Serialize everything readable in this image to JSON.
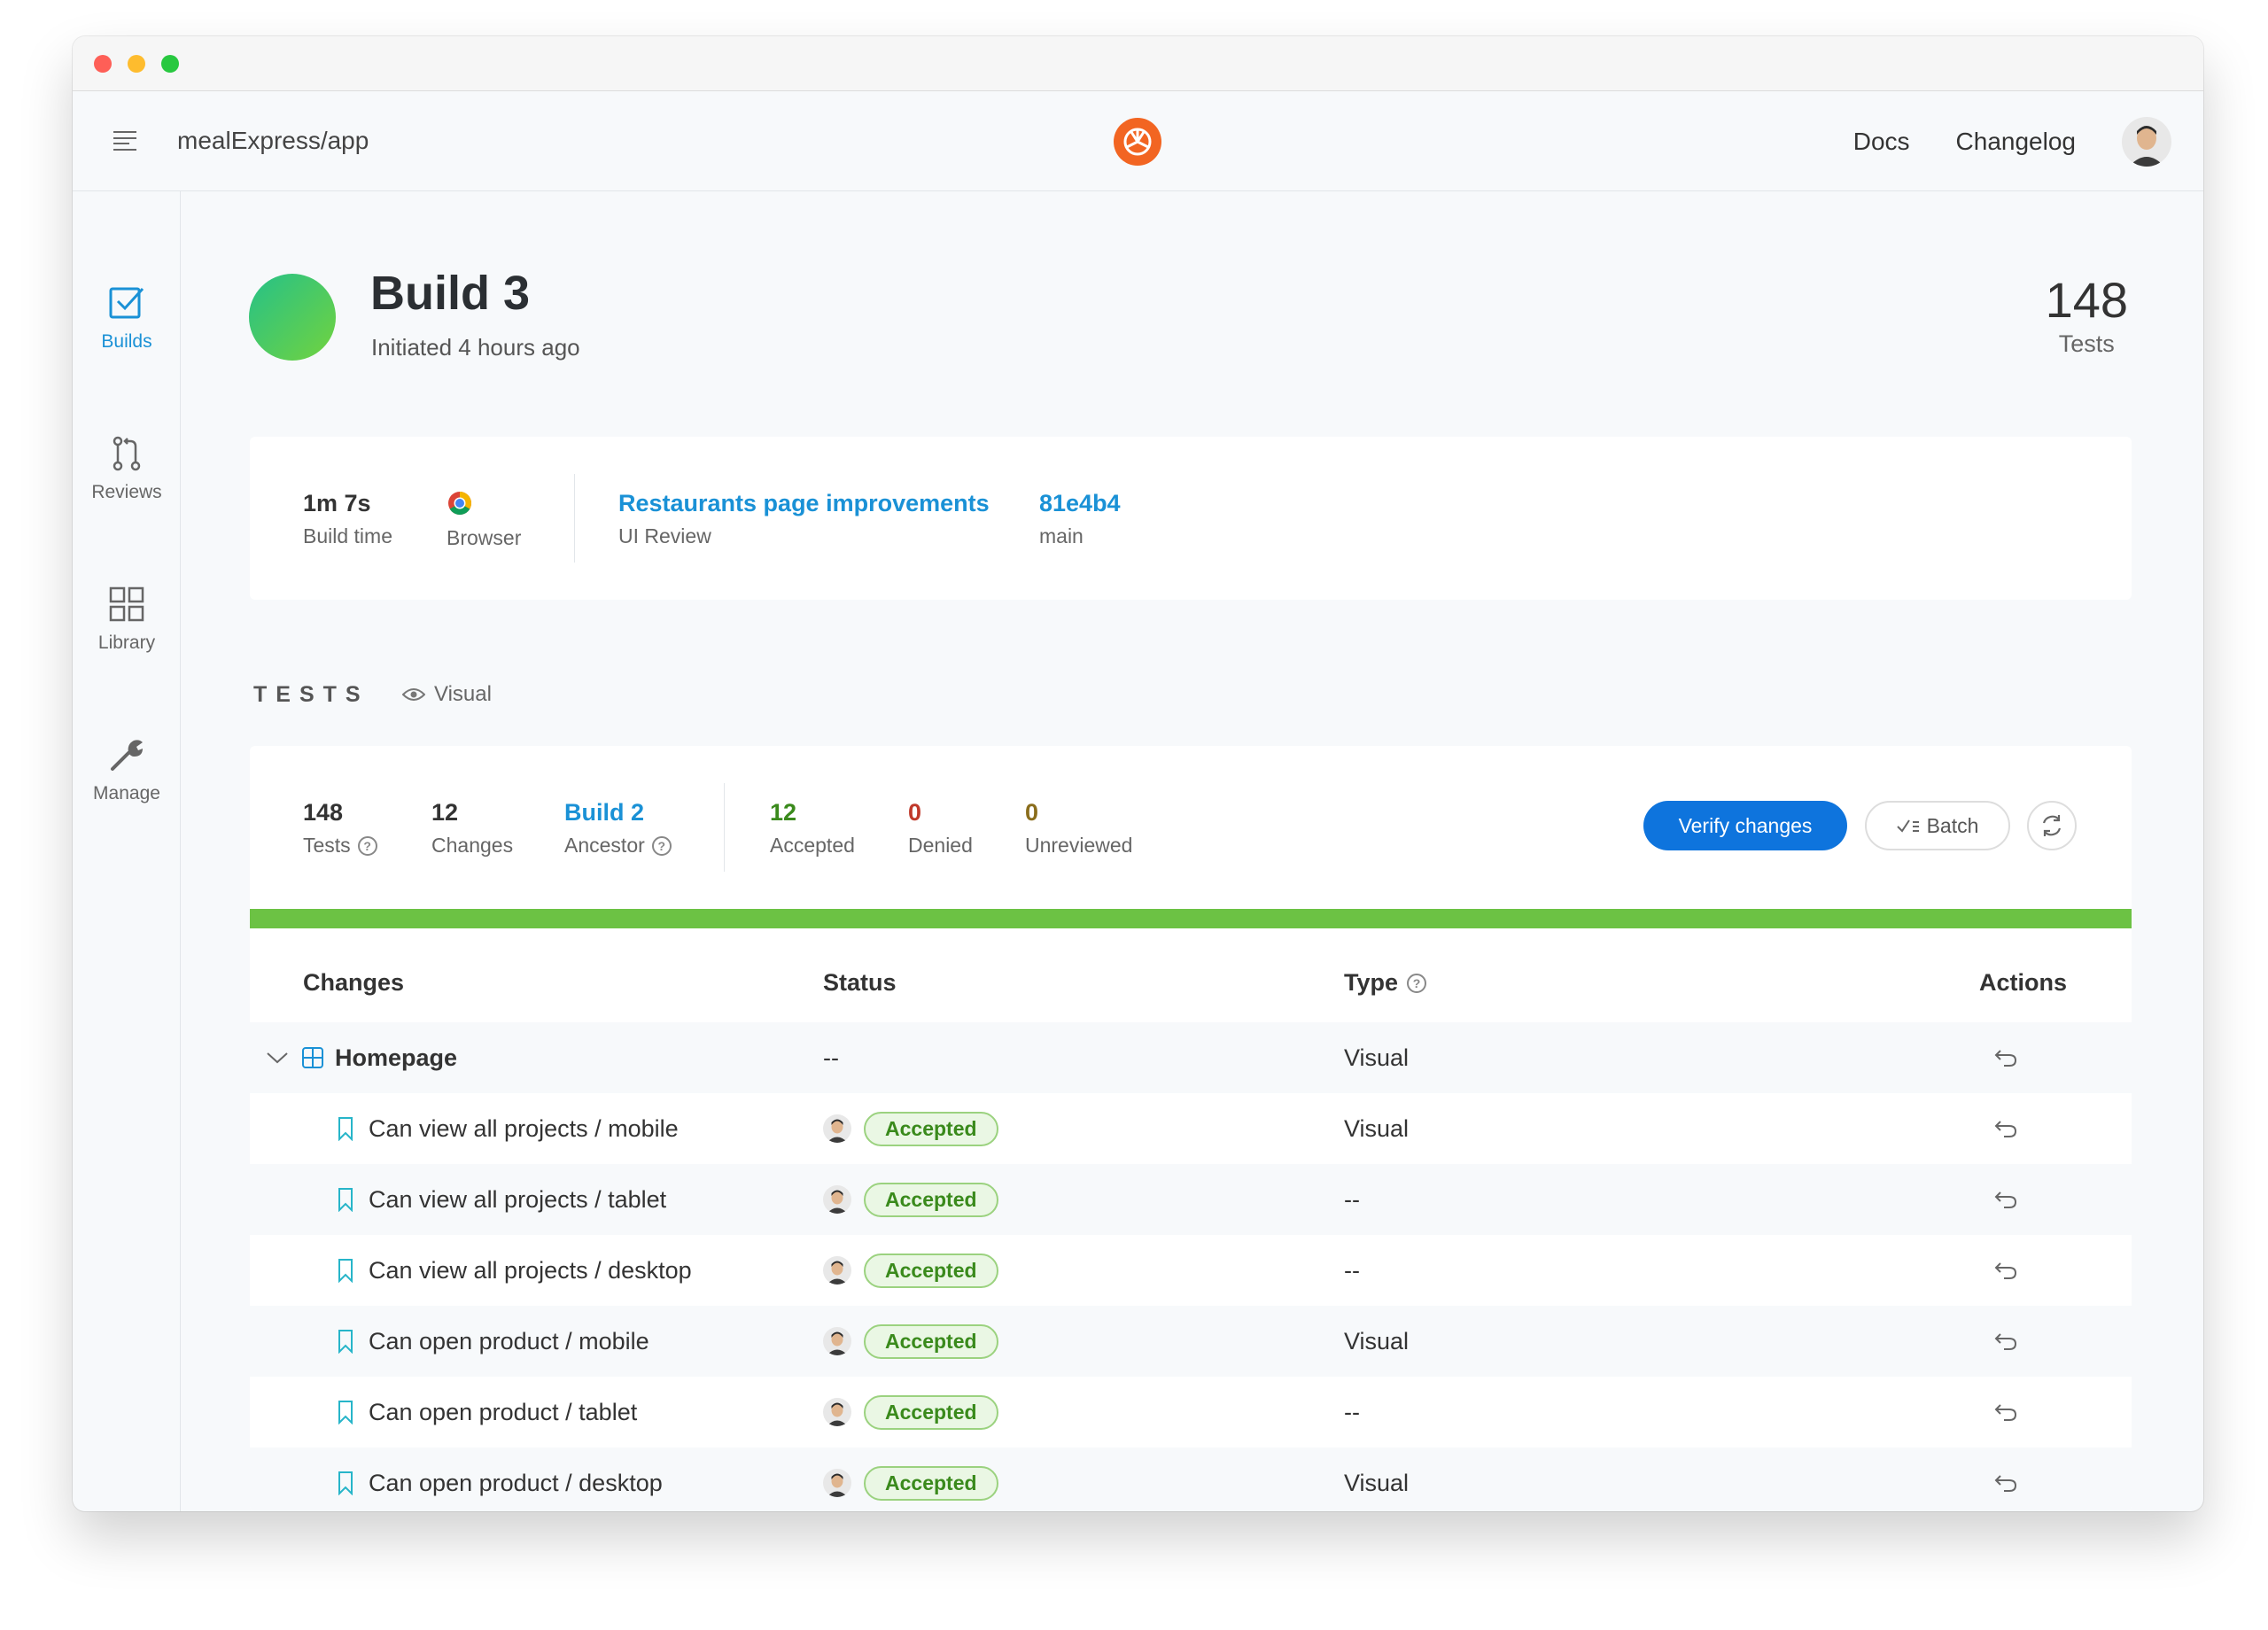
{
  "window": {
    "traffic_lights": [
      {
        "name": "close",
        "color": "#fe5f57"
      },
      {
        "name": "minimize",
        "color": "#febc2e"
      },
      {
        "name": "zoom",
        "color": "#28c840"
      }
    ]
  },
  "appbar": {
    "repo": "mealExpress/app",
    "nav": [
      "Docs",
      "Changelog"
    ],
    "brand_color": "#f26522"
  },
  "sidebar": {
    "items": [
      {
        "label": "Builds",
        "icon": "checkbox-icon",
        "active": true
      },
      {
        "label": "Reviews",
        "icon": "pull-request-icon",
        "active": false
      },
      {
        "label": "Library",
        "icon": "grid-icon",
        "active": false
      },
      {
        "label": "Manage",
        "icon": "wrench-icon",
        "active": false
      }
    ]
  },
  "build": {
    "title": "Build 3",
    "subtitle": "Initiated 4 hours ago",
    "tests_count": "148",
    "tests_label": "Tests"
  },
  "info": {
    "build_time": {
      "value": "1m 7s",
      "label": "Build time"
    },
    "browser": {
      "label": "Browser",
      "icon": "chrome-icon"
    },
    "review": {
      "value": "Restaurants page improvements",
      "label": "UI Review"
    },
    "commit": {
      "value": "81e4b4",
      "label": "main"
    }
  },
  "tests_section": {
    "heading": "TESTS",
    "filter": "Visual"
  },
  "stats": {
    "tests": {
      "value": "148",
      "label": "Tests"
    },
    "changes": {
      "value": "12",
      "label": "Changes"
    },
    "ancestor": {
      "value": "Build 2",
      "label": "Ancestor"
    },
    "accepted": {
      "value": "12",
      "label": "Accepted",
      "color": "#3a8a1c"
    },
    "denied": {
      "value": "0",
      "label": "Denied",
      "color": "#c0392b"
    },
    "unreviewed": {
      "value": "0",
      "label": "Unreviewed",
      "color": "#8a6d1c"
    },
    "verify_label": "Verify changes",
    "batch_label": "Batch",
    "progress_accepted_fraction": 1.0
  },
  "table": {
    "headers": {
      "changes": "Changes",
      "status": "Status",
      "type": "Type",
      "actions": "Actions"
    },
    "group": {
      "name": "Homepage",
      "status": "--",
      "type": "Visual"
    },
    "rows": [
      {
        "name": "Can view all projects / mobile",
        "status": "Accepted",
        "type": "Visual"
      },
      {
        "name": "Can view all projects / tablet",
        "status": "Accepted",
        "type": "--"
      },
      {
        "name": "Can view all projects / desktop",
        "status": "Accepted",
        "type": "--"
      },
      {
        "name": "Can open product / mobile",
        "status": "Accepted",
        "type": "Visual"
      },
      {
        "name": "Can open product / tablet",
        "status": "Accepted",
        "type": "--"
      },
      {
        "name": "Can open product / desktop",
        "status": "Accepted",
        "type": "Visual"
      }
    ]
  }
}
